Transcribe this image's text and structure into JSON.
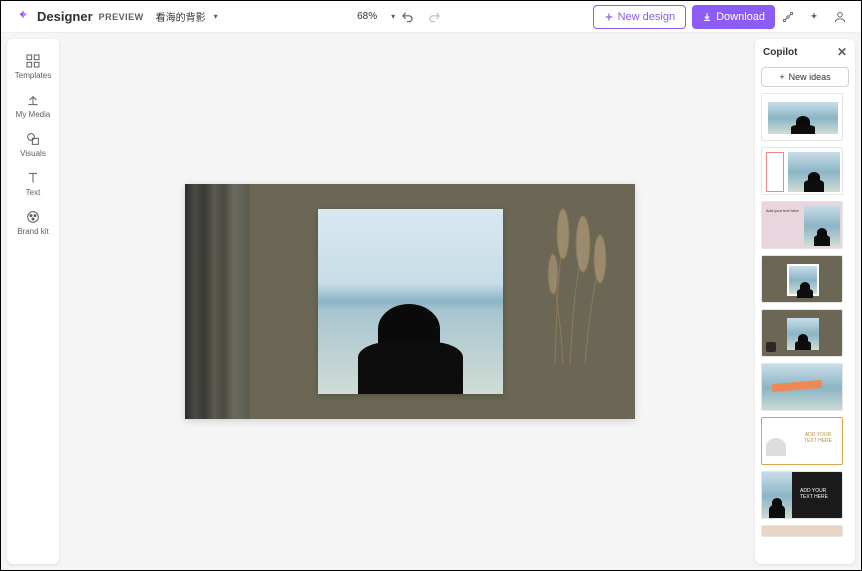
{
  "header": {
    "brand": "Designer",
    "preview": "PREVIEW",
    "doc_title": "看海的背影",
    "zoom": "68%"
  },
  "buttons": {
    "new_design": "New design",
    "download": "Download"
  },
  "sidebar": {
    "items": [
      {
        "label": "Templates"
      },
      {
        "label": "My Media"
      },
      {
        "label": "Visuals"
      },
      {
        "label": "Text"
      },
      {
        "label": "Brand kit"
      }
    ]
  },
  "copilot": {
    "title": "Copilot",
    "new_ideas": "New ideas"
  },
  "idea_labels": {
    "add_text": "Add your text here",
    "add_text_caps": "ADD YOUR TEXT HERE"
  }
}
